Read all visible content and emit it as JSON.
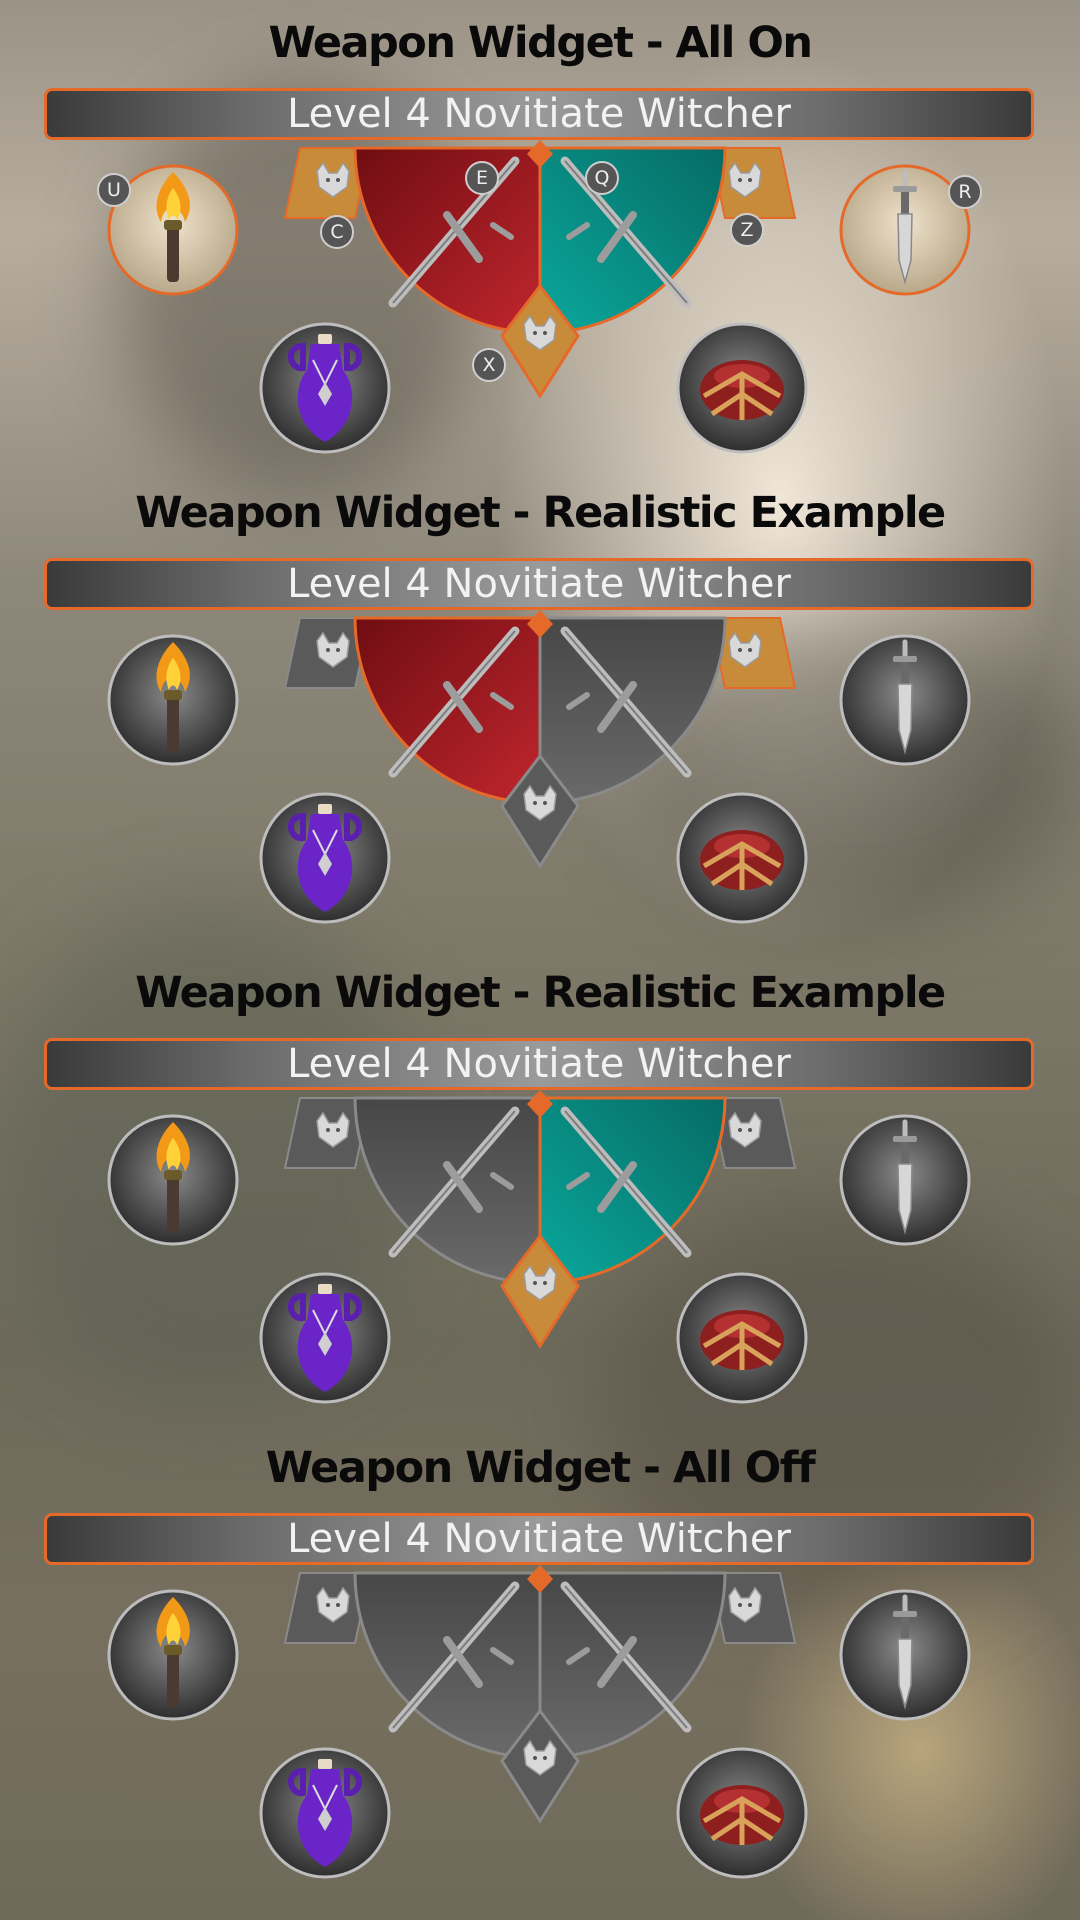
{
  "sections": [
    {
      "title": "Weapon Widget - All On",
      "level_bar": "Level 4 Novitiate Witcher",
      "keys": {
        "torch": "U",
        "steel_sword": "E",
        "silver_sword": "Q",
        "left_ornament": "C",
        "right_ornament": "Z",
        "dagger": "R",
        "center": "X"
      },
      "state": {
        "steel": "on",
        "silver": "on",
        "left_orn": "on",
        "right_orn": "on",
        "center": "on",
        "torch": "on",
        "dagger": "on"
      }
    },
    {
      "title": "Weapon Widget - Realistic Example",
      "level_bar": "Level 4 Novitiate Witcher",
      "state": {
        "steel": "on",
        "silver": "off",
        "left_orn": "off",
        "right_orn": "on",
        "center": "off",
        "torch": "off",
        "dagger": "off"
      }
    },
    {
      "title": "Weapon Widget - Realistic Example",
      "level_bar": "Level 4 Novitiate Witcher",
      "state": {
        "steel": "off",
        "silver": "on",
        "left_orn": "off",
        "right_orn": "off",
        "center": "on",
        "torch": "off",
        "dagger": "off"
      }
    },
    {
      "title": "Weapon Widget - All Off",
      "level_bar": "Level 4 Novitiate Witcher",
      "state": {
        "steel": "off",
        "silver": "off",
        "left_orn": "off",
        "right_orn": "off",
        "center": "off",
        "torch": "off",
        "dagger": "off"
      }
    }
  ],
  "icons": {
    "torch": "torch-icon",
    "dagger": "dagger-icon",
    "potion": "potion-bottle-icon",
    "bomb": "bomb-pouch-icon",
    "steel_sword": "steel-sword-icon",
    "silver_sword": "silver-sword-icon",
    "wolf_medallion": "wolf-medallion-icon"
  },
  "colors": {
    "accent": "#e56a2a",
    "steel_active": "#a31520",
    "silver_active": "#079a90",
    "inactive": "#5a5a5a",
    "ornament_active": "#c88b3a"
  }
}
